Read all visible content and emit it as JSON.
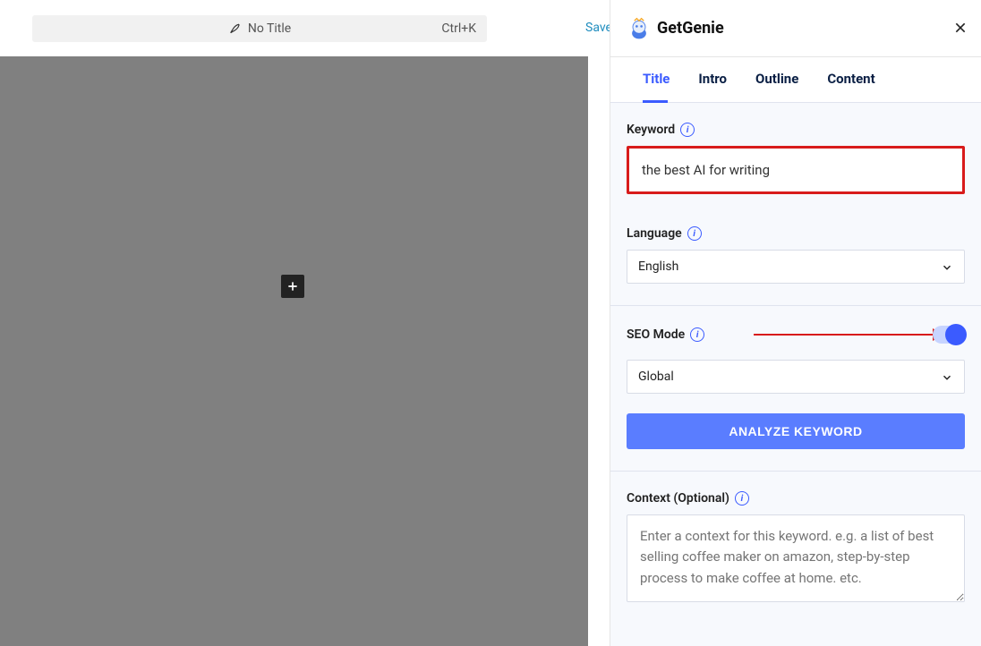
{
  "header": {
    "title_placeholder": "No Title",
    "shortcut": "Ctrl+K",
    "save_label": "Save"
  },
  "brand": {
    "name_part1": "Get",
    "name_part2": "Genie"
  },
  "tabs": [
    {
      "id": "title",
      "label": "Title",
      "active": true
    },
    {
      "id": "intro",
      "label": "Intro",
      "active": false
    },
    {
      "id": "outline",
      "label": "Outline",
      "active": false
    },
    {
      "id": "content",
      "label": "Content",
      "active": false
    }
  ],
  "fields": {
    "keyword": {
      "label": "Keyword",
      "value": "the best AI for writing"
    },
    "language": {
      "label": "Language",
      "selected": "English"
    },
    "seo_mode": {
      "label": "SEO Mode",
      "enabled": true,
      "region_selected": "Global"
    },
    "analyze_button": "ANALYZE KEYWORD",
    "context": {
      "label": "Context (Optional)",
      "placeholder": "Enter a context for this keyword. e.g. a list of best selling coffee maker on amazon, step-by-step process to make coffee at home. etc."
    }
  }
}
